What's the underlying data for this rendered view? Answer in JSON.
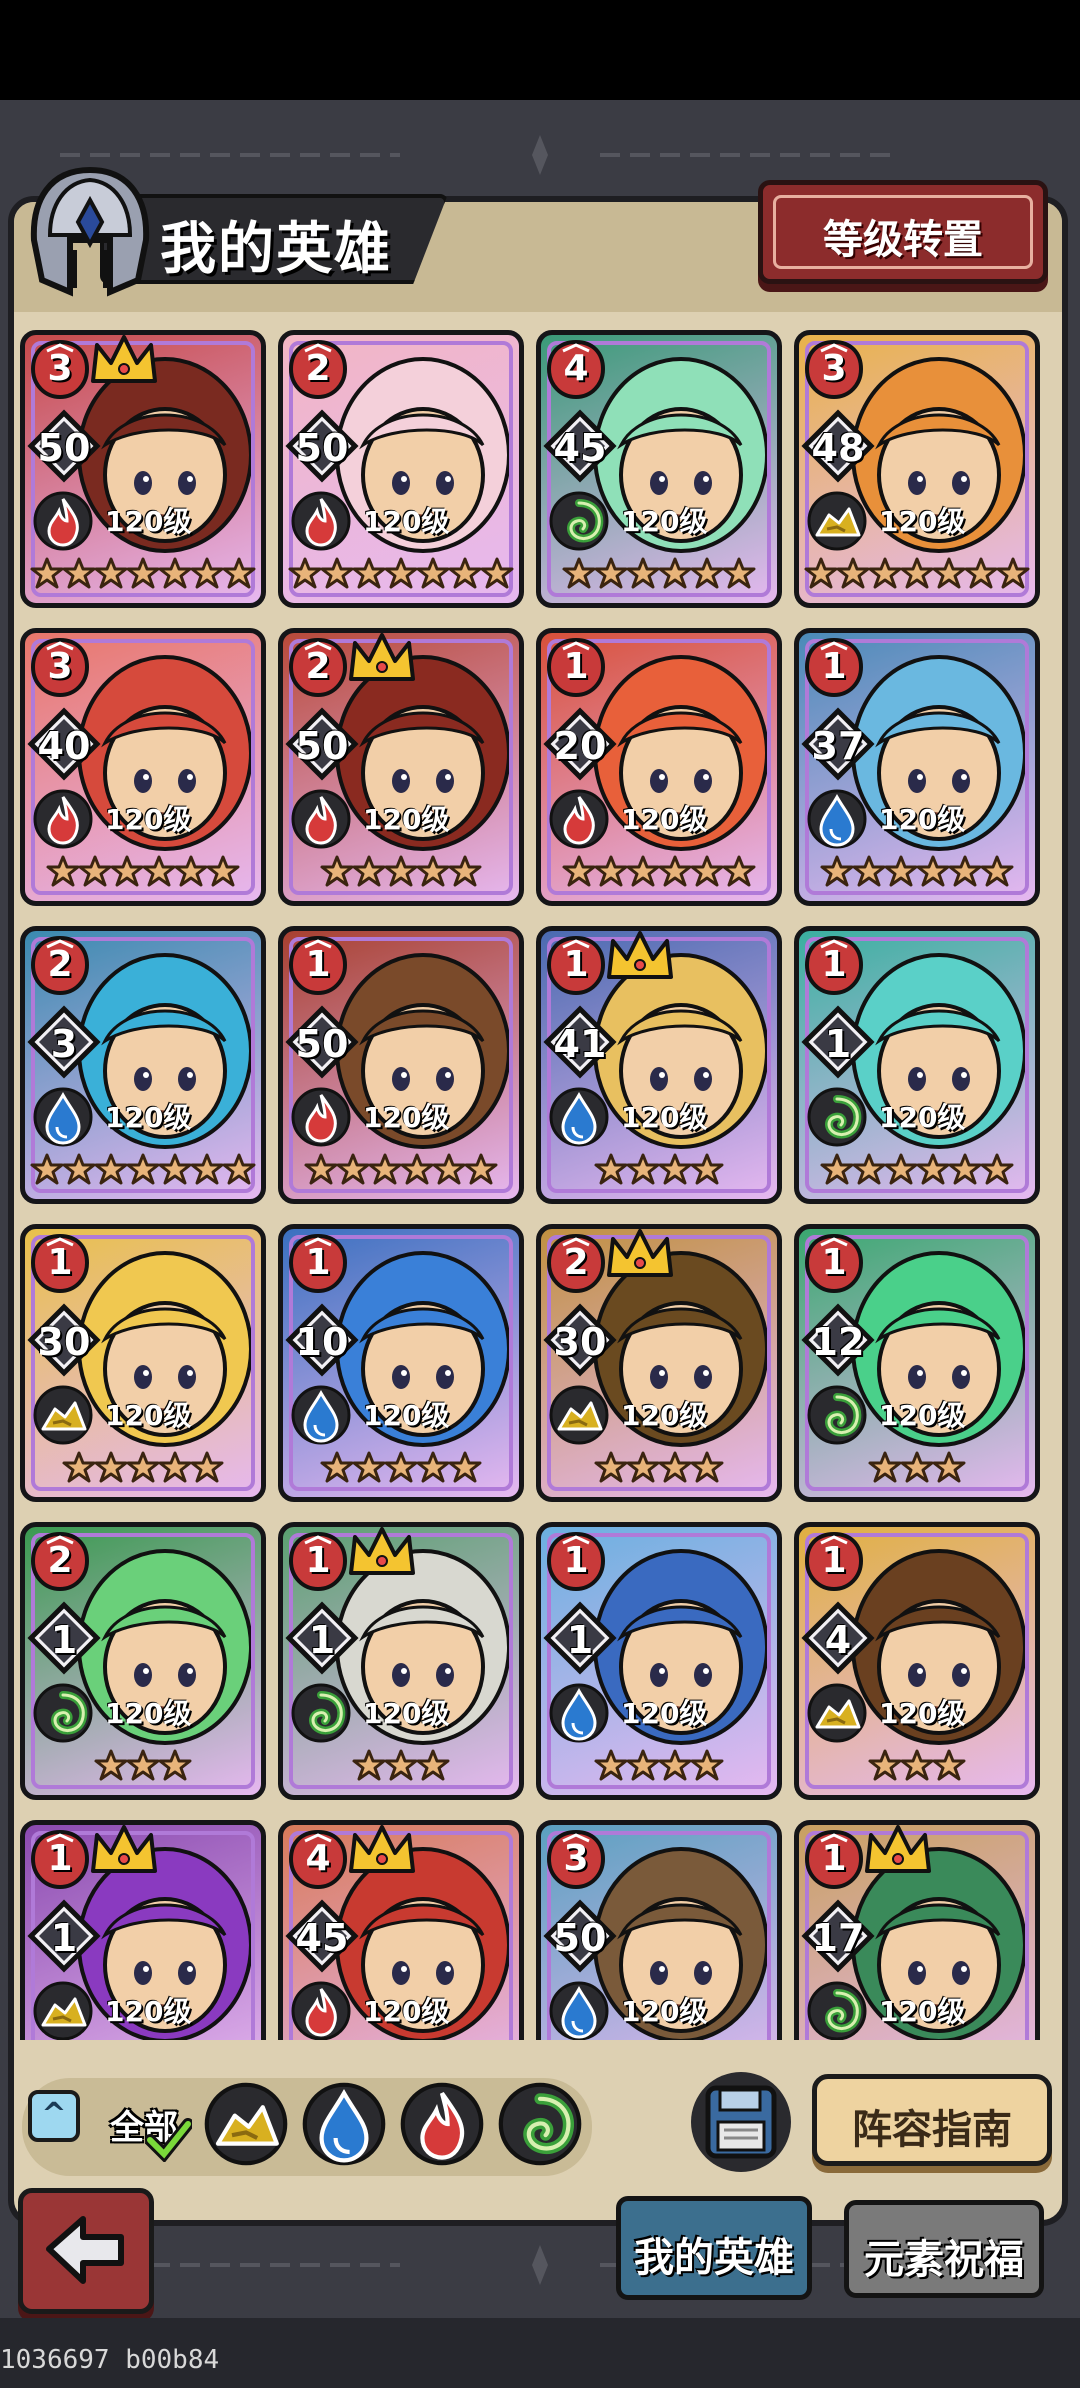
{
  "header": {
    "title": "我的英雄",
    "level_transfer_label": "等级转置"
  },
  "heroes": [
    {
      "rank": "3",
      "level": "50",
      "level_text": "120级",
      "element": "fire",
      "stars": 7,
      "crown": true,
      "bg": "#c74a4a",
      "hair": "#7a2a20"
    },
    {
      "rank": "2",
      "level": "50",
      "level_text": "120级",
      "element": "fire",
      "stars": 7,
      "crown": false,
      "bg": "#f2b6c4",
      "hair": "#f4d0da"
    },
    {
      "rank": "4",
      "level": "45",
      "level_text": "120级",
      "element": "wind",
      "stars": 6,
      "crown": false,
      "bg": "#3a9a78",
      "hair": "#8fe0b8"
    },
    {
      "rank": "3",
      "level": "48",
      "level_text": "120级",
      "element": "earth",
      "stars": 7,
      "crown": false,
      "bg": "#e8b24a",
      "hair": "#e8903a"
    },
    {
      "rank": "3",
      "level": "40",
      "level_text": "120级",
      "element": "fire",
      "stars": 6,
      "crown": false,
      "bg": "#e8766a",
      "hair": "#d64a3c"
    },
    {
      "rank": "2",
      "level": "50",
      "level_text": "120级",
      "element": "fire",
      "stars": 5,
      "crown": true,
      "bg": "#b84a3a",
      "hair": "#8a2a20"
    },
    {
      "rank": "1",
      "level": "20",
      "level_text": "120级",
      "element": "fire",
      "stars": 6,
      "crown": false,
      "bg": "#d8503a",
      "hair": "#e8603a"
    },
    {
      "rank": "1",
      "level": "37",
      "level_text": "120级",
      "element": "water",
      "stars": 6,
      "crown": false,
      "bg": "#4a8ab8",
      "hair": "#6ab8e0"
    },
    {
      "rank": "2",
      "level": "3",
      "level_text": "120级",
      "element": "water",
      "stars": 7,
      "crown": false,
      "bg": "#3a8ab0",
      "hair": "#3ab0d8"
    },
    {
      "rank": "1",
      "level": "50",
      "level_text": "120级",
      "element": "fire",
      "stars": 6,
      "crown": false,
      "bg": "#a84030",
      "hair": "#7a4a2a"
    },
    {
      "rank": "1",
      "level": "41",
      "level_text": "120级",
      "element": "water",
      "stars": 4,
      "crown": true,
      "bg": "#4a6ab0",
      "hair": "#e8c060"
    },
    {
      "rank": "1",
      "level": "1",
      "level_text": "120级",
      "element": "wind",
      "stars": 6,
      "crown": false,
      "bg": "#3ab0a0",
      "hair": "#5ad0c8"
    },
    {
      "rank": "1",
      "level": "30",
      "level_text": "120级",
      "element": "earth",
      "stars": 5,
      "crown": false,
      "bg": "#e8c04a",
      "hair": "#f0c850"
    },
    {
      "rank": "1",
      "level": "10",
      "level_text": "120级",
      "element": "water",
      "stars": 5,
      "crown": false,
      "bg": "#3a70c0",
      "hair": "#3a80d8"
    },
    {
      "rank": "2",
      "level": "30",
      "level_text": "120级",
      "element": "earth",
      "stars": 4,
      "crown": true,
      "bg": "#c09040",
      "hair": "#6a4a20"
    },
    {
      "rank": "1",
      "level": "12",
      "level_text": "120级",
      "element": "wind",
      "stars": 3,
      "crown": false,
      "bg": "#3aa870",
      "hair": "#4ad08a"
    },
    {
      "rank": "2",
      "level": "1",
      "level_text": "120级",
      "element": "wind",
      "stars": 3,
      "crown": false,
      "bg": "#3a9a50",
      "hair": "#6ad07a"
    },
    {
      "rank": "1",
      "level": "1",
      "level_text": "120级",
      "element": "wind",
      "stars": 3,
      "crown": true,
      "bg": "#5aa070",
      "hair": "#d8d8d0"
    },
    {
      "rank": "1",
      "level": "1",
      "level_text": "120级",
      "element": "water",
      "stars": 4,
      "crown": false,
      "bg": "#6ab0e0",
      "hair": "#3a6ac0"
    },
    {
      "rank": "1",
      "level": "4",
      "level_text": "120级",
      "element": "earth",
      "stars": 3,
      "crown": false,
      "bg": "#e0b040",
      "hair": "#6a4020"
    },
    {
      "rank": "1",
      "level": "1",
      "level_text": "120级",
      "element": "earth",
      "stars": 0,
      "crown": true,
      "bg": "#8a4ab0",
      "hair": "#8a3ac0"
    },
    {
      "rank": "4",
      "level": "45",
      "level_text": "120级",
      "element": "fire",
      "stars": 0,
      "crown": true,
      "bg": "#d87a5a",
      "hair": "#c83a30"
    },
    {
      "rank": "3",
      "level": "50",
      "level_text": "120级",
      "element": "water",
      "stars": 0,
      "crown": false,
      "bg": "#5aa0c0",
      "hair": "#7a5a3a"
    },
    {
      "rank": "1",
      "level": "17",
      "level_text": "120级",
      "element": "wind",
      "stars": 0,
      "crown": true,
      "bg": "#c8a060",
      "hair": "#3a8a5a"
    }
  ],
  "filters": {
    "all_label": "全部",
    "elements": [
      "earth",
      "water",
      "fire",
      "wind"
    ]
  },
  "buttons": {
    "lineup_guide": "阵容指南"
  },
  "tabs": {
    "my_heroes": "我的英雄",
    "element_blessing": "元素祝福"
  },
  "watermark": "1036697 b00b84",
  "colors": {
    "fire": "#d63a3a",
    "water": "#2a7ad0",
    "wind": "#3aa03a",
    "earth": "#d8b020"
  }
}
